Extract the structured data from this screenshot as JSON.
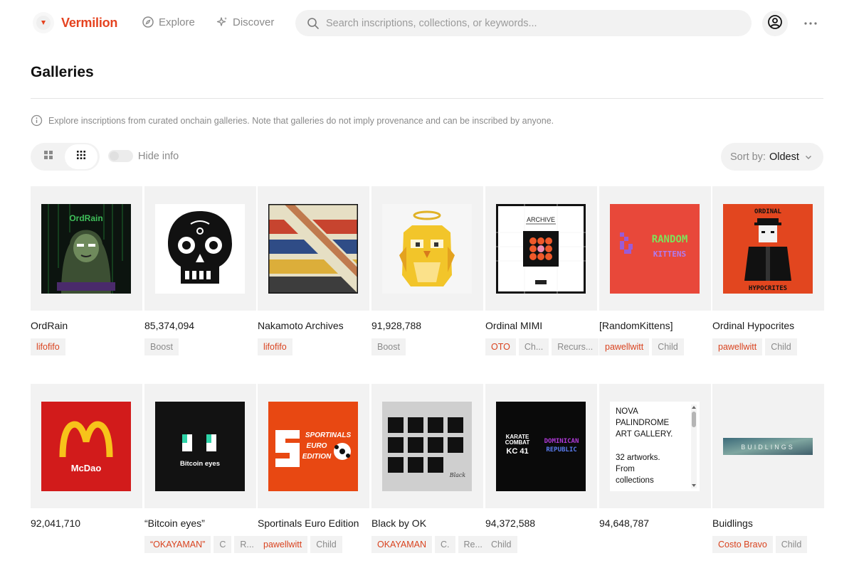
{
  "header": {
    "logo_text": "Vermilion",
    "nav": [
      {
        "label": "Explore",
        "icon": "compass-icon"
      },
      {
        "label": "Discover",
        "icon": "sparkle-icon"
      }
    ],
    "search_placeholder": "Search inscriptions, collections, or keywords...",
    "profile_icon": "user-circle-icon",
    "more_icon": "more-dots-icon"
  },
  "page": {
    "title": "Galleries",
    "note": "Explore inscriptions from curated onchain galleries. Note that galleries do not imply provenance and can be inscribed by anyone."
  },
  "controls": {
    "view_modes": [
      "large-grid-icon",
      "small-grid-icon"
    ],
    "active_view": "small-grid-icon",
    "hide_info_label": "Hide info",
    "sort_label": "Sort by:",
    "sort_value": "Oldest"
  },
  "colors": {
    "brand": "#e5421f",
    "tag_red": "#d9431f",
    "muted": "#8a8a8a",
    "surface": "#f2f2f2"
  },
  "galleries": [
    {
      "name": "OrdRain",
      "art": "ordrain",
      "art_text": "OrdRain",
      "tags": [
        {
          "label": "lifofifo",
          "red": true
        }
      ]
    },
    {
      "name": "85,374,094",
      "art": "skull",
      "tags": [
        {
          "label": "Boost",
          "red": false
        }
      ]
    },
    {
      "name": "Nakamoto Archives",
      "art": "stripes",
      "tags": [
        {
          "label": "lifofifo",
          "red": true
        }
      ]
    },
    {
      "name": "91,928,788",
      "art": "owl",
      "tags": [
        {
          "label": "Boost",
          "red": false
        }
      ]
    },
    {
      "name": "Ordinal MIMI",
      "art": "archive",
      "art_text": "ARCHIVE",
      "tags": [
        {
          "label": "OTO",
          "red": true
        },
        {
          "label": "Ch...",
          "red": false
        },
        {
          "label": "Recurs...",
          "red": false
        }
      ]
    },
    {
      "name": "[RandomKittens]",
      "art": "kittens",
      "art_text": [
        "RANDOM",
        "KITTENS"
      ],
      "tags": [
        {
          "label": "pawellwitt",
          "red": true
        },
        {
          "label": "Child",
          "red": false
        }
      ]
    },
    {
      "name": "Ordinal Hypocrites",
      "art": "hypocrites",
      "art_text": [
        "ORDINAL",
        "HYPOCRITES"
      ],
      "tags": [
        {
          "label": "pawellwitt",
          "red": true
        },
        {
          "label": "Child",
          "red": false
        }
      ]
    },
    {
      "name": "92,041,710",
      "art": "mcdao",
      "art_text": "McDao",
      "tags": []
    },
    {
      "name": "“Bitcoin eyes”",
      "art": "eyes",
      "art_text": "Bitcoin eyes",
      "tags": [
        {
          "label": "“OKAYAMAN”",
          "red": true
        },
        {
          "label": "C",
          "red": false
        },
        {
          "label": "R...",
          "red": false
        }
      ]
    },
    {
      "name": "Sportinals Euro Edition",
      "art": "sportinals",
      "art_text": [
        "SPORTINALS",
        "EURO",
        "EDITION"
      ],
      "tags": [
        {
          "label": "pawellwitt",
          "red": true
        },
        {
          "label": "Child",
          "red": false
        }
      ]
    },
    {
      "name": "Black by OK",
      "art": "black",
      "art_text": "Black",
      "tags": [
        {
          "label": "OKAYAMAN",
          "red": true
        },
        {
          "label": "C.",
          "red": false
        },
        {
          "label": "Re...",
          "red": false
        }
      ]
    },
    {
      "name": "94,372,588",
      "art": "karate",
      "art_text": [
        "KARATE",
        "COMBAT",
        "KC 41",
        "DOMINICAN",
        "REPUBLIC"
      ],
      "tags": [
        {
          "label": "Child",
          "red": false
        }
      ]
    },
    {
      "name": "94,648,787",
      "art": "nova",
      "art_text": [
        "NOVA",
        "PALINDROME",
        "ART GALLERY.",
        "",
        "32 artworks.",
        "From",
        "collections"
      ],
      "tags": []
    },
    {
      "name": "Buidlings",
      "art": "buidlings",
      "art_text": "BUIDLINGS",
      "tags": [
        {
          "label": "Costo Bravo",
          "red": true
        },
        {
          "label": "Child",
          "red": false
        }
      ]
    }
  ]
}
